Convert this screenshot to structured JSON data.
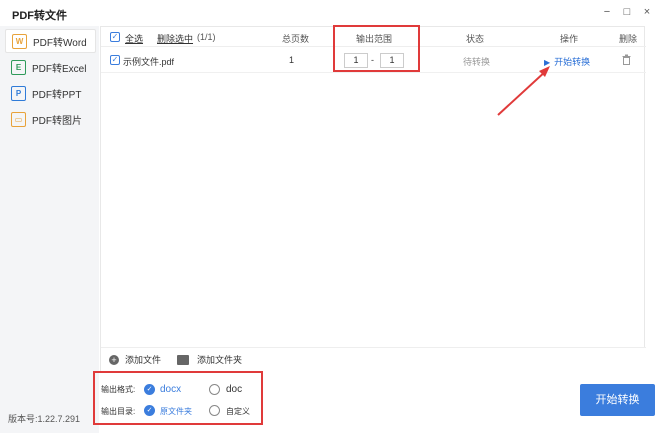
{
  "app": {
    "title": "PDF转文件"
  },
  "window_controls": {
    "minimize": "−",
    "maximize": "□",
    "close": "×"
  },
  "sidebar": {
    "items": [
      {
        "label": "PDF转Word",
        "icon": "word-icon",
        "glyph": "W",
        "color": "#e8a23a",
        "active": true
      },
      {
        "label": "PDF转Excel",
        "icon": "excel-icon",
        "glyph": "E",
        "color": "#2e9a5a",
        "active": false
      },
      {
        "label": "PDF转PPT",
        "icon": "ppt-icon",
        "glyph": "P",
        "color": "#2f7bd8",
        "active": false
      },
      {
        "label": "PDF转图片",
        "icon": "image-icon",
        "glyph": "▭",
        "color": "#e8a23a",
        "active": false
      }
    ],
    "version": "版本号:1.22.7.291"
  },
  "list": {
    "header": {
      "select_all": "全选",
      "delete_selected": "删除选中",
      "count": "(1/1)",
      "total_pages": "总页数",
      "output_range": "输出范围",
      "status": "状态",
      "action": "操作",
      "delete": "删除"
    },
    "files": [
      {
        "name": "示例文件.pdf",
        "pages": "1",
        "range_from": "1",
        "range_sep": "-",
        "range_to": "1",
        "status": "待转换",
        "action": "开始转换"
      }
    ],
    "footer": {
      "add_file": "添加文件",
      "add_folder": "添加文件夹"
    }
  },
  "options": {
    "format_label": "输出格式:",
    "format_options": [
      "docx",
      "doc"
    ],
    "format_selected": "docx",
    "dir_label": "输出目录:",
    "dir_options": [
      "原文件夹",
      "自定义"
    ],
    "dir_selected": "原文件夹"
  },
  "convert_button": "开始转换",
  "colors": {
    "accent": "#3b7ddd",
    "highlight": "#e03a3a"
  }
}
